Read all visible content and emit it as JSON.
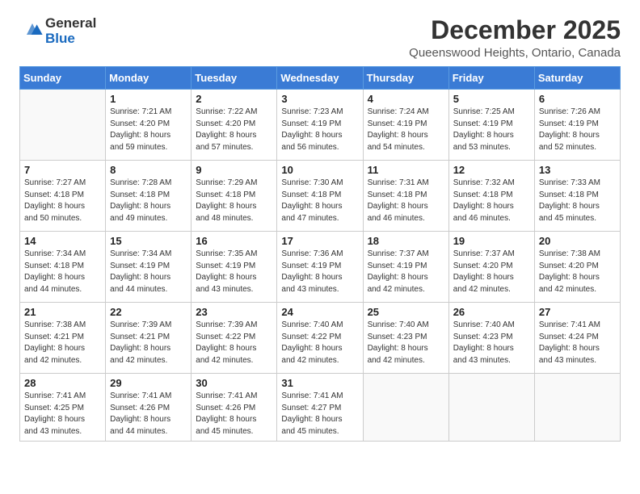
{
  "header": {
    "logo_line1": "General",
    "logo_line2": "Blue",
    "month": "December 2025",
    "location": "Queenswood Heights, Ontario, Canada"
  },
  "weekdays": [
    "Sunday",
    "Monday",
    "Tuesday",
    "Wednesday",
    "Thursday",
    "Friday",
    "Saturday"
  ],
  "weeks": [
    [
      {
        "day": "",
        "info": ""
      },
      {
        "day": "1",
        "info": "Sunrise: 7:21 AM\nSunset: 4:20 PM\nDaylight: 8 hours\nand 59 minutes."
      },
      {
        "day": "2",
        "info": "Sunrise: 7:22 AM\nSunset: 4:20 PM\nDaylight: 8 hours\nand 57 minutes."
      },
      {
        "day": "3",
        "info": "Sunrise: 7:23 AM\nSunset: 4:19 PM\nDaylight: 8 hours\nand 56 minutes."
      },
      {
        "day": "4",
        "info": "Sunrise: 7:24 AM\nSunset: 4:19 PM\nDaylight: 8 hours\nand 54 minutes."
      },
      {
        "day": "5",
        "info": "Sunrise: 7:25 AM\nSunset: 4:19 PM\nDaylight: 8 hours\nand 53 minutes."
      },
      {
        "day": "6",
        "info": "Sunrise: 7:26 AM\nSunset: 4:19 PM\nDaylight: 8 hours\nand 52 minutes."
      }
    ],
    [
      {
        "day": "7",
        "info": "Sunrise: 7:27 AM\nSunset: 4:18 PM\nDaylight: 8 hours\nand 50 minutes."
      },
      {
        "day": "8",
        "info": "Sunrise: 7:28 AM\nSunset: 4:18 PM\nDaylight: 8 hours\nand 49 minutes."
      },
      {
        "day": "9",
        "info": "Sunrise: 7:29 AM\nSunset: 4:18 PM\nDaylight: 8 hours\nand 48 minutes."
      },
      {
        "day": "10",
        "info": "Sunrise: 7:30 AM\nSunset: 4:18 PM\nDaylight: 8 hours\nand 47 minutes."
      },
      {
        "day": "11",
        "info": "Sunrise: 7:31 AM\nSunset: 4:18 PM\nDaylight: 8 hours\nand 46 minutes."
      },
      {
        "day": "12",
        "info": "Sunrise: 7:32 AM\nSunset: 4:18 PM\nDaylight: 8 hours\nand 46 minutes."
      },
      {
        "day": "13",
        "info": "Sunrise: 7:33 AM\nSunset: 4:18 PM\nDaylight: 8 hours\nand 45 minutes."
      }
    ],
    [
      {
        "day": "14",
        "info": "Sunrise: 7:34 AM\nSunset: 4:18 PM\nDaylight: 8 hours\nand 44 minutes."
      },
      {
        "day": "15",
        "info": "Sunrise: 7:34 AM\nSunset: 4:19 PM\nDaylight: 8 hours\nand 44 minutes."
      },
      {
        "day": "16",
        "info": "Sunrise: 7:35 AM\nSunset: 4:19 PM\nDaylight: 8 hours\nand 43 minutes."
      },
      {
        "day": "17",
        "info": "Sunrise: 7:36 AM\nSunset: 4:19 PM\nDaylight: 8 hours\nand 43 minutes."
      },
      {
        "day": "18",
        "info": "Sunrise: 7:37 AM\nSunset: 4:19 PM\nDaylight: 8 hours\nand 42 minutes."
      },
      {
        "day": "19",
        "info": "Sunrise: 7:37 AM\nSunset: 4:20 PM\nDaylight: 8 hours\nand 42 minutes."
      },
      {
        "day": "20",
        "info": "Sunrise: 7:38 AM\nSunset: 4:20 PM\nDaylight: 8 hours\nand 42 minutes."
      }
    ],
    [
      {
        "day": "21",
        "info": "Sunrise: 7:38 AM\nSunset: 4:21 PM\nDaylight: 8 hours\nand 42 minutes."
      },
      {
        "day": "22",
        "info": "Sunrise: 7:39 AM\nSunset: 4:21 PM\nDaylight: 8 hours\nand 42 minutes."
      },
      {
        "day": "23",
        "info": "Sunrise: 7:39 AM\nSunset: 4:22 PM\nDaylight: 8 hours\nand 42 minutes."
      },
      {
        "day": "24",
        "info": "Sunrise: 7:40 AM\nSunset: 4:22 PM\nDaylight: 8 hours\nand 42 minutes."
      },
      {
        "day": "25",
        "info": "Sunrise: 7:40 AM\nSunset: 4:23 PM\nDaylight: 8 hours\nand 42 minutes."
      },
      {
        "day": "26",
        "info": "Sunrise: 7:40 AM\nSunset: 4:23 PM\nDaylight: 8 hours\nand 43 minutes."
      },
      {
        "day": "27",
        "info": "Sunrise: 7:41 AM\nSunset: 4:24 PM\nDaylight: 8 hours\nand 43 minutes."
      }
    ],
    [
      {
        "day": "28",
        "info": "Sunrise: 7:41 AM\nSunset: 4:25 PM\nDaylight: 8 hours\nand 43 minutes."
      },
      {
        "day": "29",
        "info": "Sunrise: 7:41 AM\nSunset: 4:26 PM\nDaylight: 8 hours\nand 44 minutes."
      },
      {
        "day": "30",
        "info": "Sunrise: 7:41 AM\nSunset: 4:26 PM\nDaylight: 8 hours\nand 45 minutes."
      },
      {
        "day": "31",
        "info": "Sunrise: 7:41 AM\nSunset: 4:27 PM\nDaylight: 8 hours\nand 45 minutes."
      },
      {
        "day": "",
        "info": ""
      },
      {
        "day": "",
        "info": ""
      },
      {
        "day": "",
        "info": ""
      }
    ]
  ]
}
